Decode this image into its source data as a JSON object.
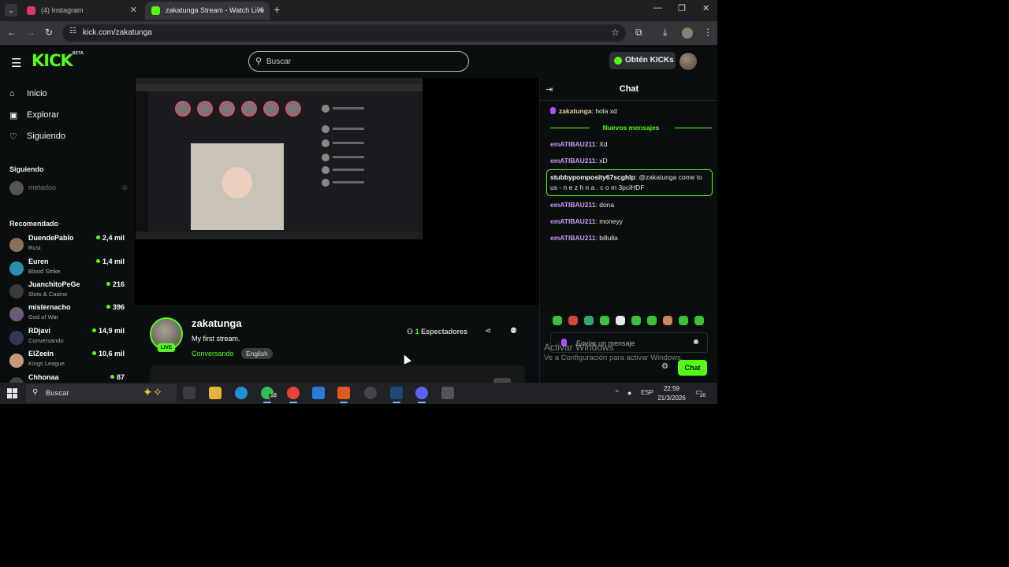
{
  "browser": {
    "tabs": [
      {
        "title": "(4) Instagram",
        "active": false,
        "favicon_color": "#e1306c"
      },
      {
        "title": "zakatunga Stream - Watch Live",
        "active": true,
        "favicon_color": "#53fc18"
      }
    ],
    "new_tab_label": "+",
    "url": "kick.com/zakatunga",
    "window_controls": {
      "minimize": "—",
      "maximize": "❐",
      "close": "✕"
    }
  },
  "header": {
    "logo": "KICK",
    "logo_tag": "BETA",
    "search_placeholder": "Buscar",
    "get_kicks_label": "Obtén KICKs"
  },
  "sidebar": {
    "nav": [
      {
        "label": "Inicio",
        "icon": "home-icon"
      },
      {
        "label": "Explorar",
        "icon": "compass-icon"
      },
      {
        "label": "Siguiendo",
        "icon": "heart-icon"
      }
    ],
    "following_title": "Siguiendo",
    "following": [
      {
        "name": "metaduo",
        "online": false
      }
    ],
    "recommended_title": "Recomendado",
    "recommended": [
      {
        "name": "DuendePablo",
        "category": "Rust",
        "viewers": "2,4 mil",
        "avatar_color": "#8a6f5a"
      },
      {
        "name": "Euren",
        "category": "Blood Strike",
        "viewers": "1,4 mil",
        "avatar_color": "#2b8fb0"
      },
      {
        "name": "JuanchitoPeGe",
        "category": "Slots & Casino",
        "viewers": "216",
        "avatar_color": "#3a3a3a"
      },
      {
        "name": "misternacho",
        "category": "God of War",
        "viewers": "396",
        "avatar_color": "#6a5a7a"
      },
      {
        "name": "RDjavi",
        "category": "Conversando",
        "viewers": "14,9 mil",
        "avatar_color": "#2c3a55"
      },
      {
        "name": "ElZeein",
        "category": "Kings League",
        "viewers": "10,6 mil",
        "avatar_color": "#c99a7a"
      },
      {
        "name": "Chhonaa",
        "category": "",
        "viewers": "87",
        "avatar_color": "#444"
      }
    ]
  },
  "stream": {
    "channel": "zakatunga",
    "live_badge": "LIVE",
    "title": "My first stream.",
    "category": "Conversando",
    "language": "English",
    "viewers_count": "1",
    "viewers_label": "Espectadores"
  },
  "chat": {
    "title": "Chat",
    "new_messages_label": "Nuevos mensajes",
    "messages": [
      {
        "user": "zakatunga",
        "text": "hola xd",
        "style": "pin"
      },
      {
        "user": "emATIBAU211",
        "text": "Xd",
        "style": "purple"
      },
      {
        "user": "emATIBAU211",
        "text": "xD",
        "style": "purple"
      },
      {
        "user": "stubbypomposity67scghlp",
        "text": "@zakatunga come to us - n e z h n a . c o m 3pciHDF",
        "style": "white"
      },
      {
        "user": "emATIBAU211",
        "text": "dona",
        "style": "purple"
      },
      {
        "user": "emATIBAU211",
        "text": "moneyy",
        "style": "purple"
      },
      {
        "user": "emATIBAU211",
        "text": "billulla",
        "style": "purple"
      }
    ],
    "input_placeholder": "Enviar un mensaje",
    "send_label": "Chat"
  },
  "watermark": {
    "line1": "Activar Windows",
    "line2": "Ve a Configuración para activar Windows."
  },
  "taskbar": {
    "search_label": "Buscar",
    "whatsapp_badge": "18",
    "language": "ESP",
    "time": "22:59",
    "date": "21/3/2026",
    "notifications": "20"
  },
  "colors": {
    "accent": "#53fc18",
    "background": "#0b0e0f",
    "username_purple": "#c79cf2"
  }
}
